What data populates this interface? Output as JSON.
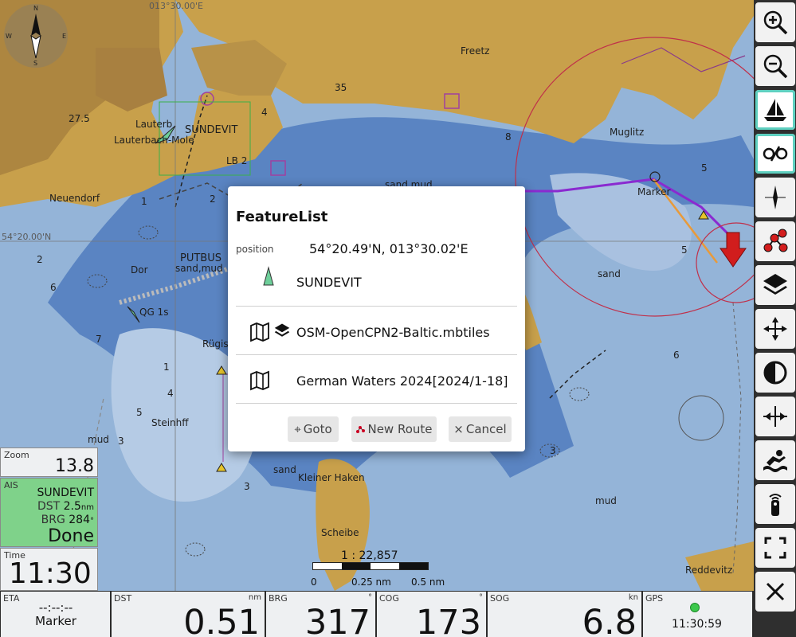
{
  "map": {
    "grid_lon": "013°30.00'E",
    "grid_lat": "54°20.00'N",
    "places": [
      "Freetz",
      "Lauterb",
      "SUNDEVIT",
      "Lauterbach-Mole",
      "Neuendorf",
      "PUTBUS",
      "sand,mud",
      "Marker",
      "Muglitz",
      "sand mud",
      "sand",
      "Rügise",
      "Steinhff",
      "Kleiner Haken",
      "Scheibe",
      "Reddevitz",
      "mud",
      "QG 1s",
      "LB 2",
      "Dor",
      "mud",
      "sand"
    ],
    "depths": [
      "27.5",
      "35",
      "2",
      "6",
      "4",
      "5",
      "3",
      "1",
      "7",
      "8",
      "3",
      "6",
      "5",
      "2",
      "4",
      "1",
      "3",
      "5"
    ],
    "scale_ratio": "1 : 22,857",
    "scale_ticks": [
      "0",
      "0.25 nm",
      "0.5 nm"
    ]
  },
  "compass": {
    "n": "N",
    "s": "S",
    "e": "E",
    "w": "W"
  },
  "toolbar": {
    "buttons": [
      {
        "name": "zoom-in-icon"
      },
      {
        "name": "zoom-out-icon"
      },
      {
        "name": "sailboat-icon"
      },
      {
        "name": "ais-toggle-icon"
      },
      {
        "name": "compass-icon"
      },
      {
        "name": "route-icon"
      },
      {
        "name": "layers-icon"
      },
      {
        "name": "center-icon"
      },
      {
        "name": "contrast-icon"
      },
      {
        "name": "anchor-icon"
      },
      {
        "name": "mob-icon"
      },
      {
        "name": "remote-icon"
      },
      {
        "name": "fullscreen-icon"
      },
      {
        "name": "close-icon"
      }
    ]
  },
  "widgets": {
    "zoom": {
      "label": "Zoom",
      "value": "13.8"
    },
    "ais": {
      "label": "AIS",
      "name": "SUNDEVIT",
      "dst_label": "DST",
      "dst_value": "2.5",
      "dst_unit": "nm",
      "brg_label": "BRG",
      "brg_value": "284",
      "brg_unit": "°",
      "status": "Done"
    },
    "time": {
      "label": "Time",
      "value": "11:30"
    }
  },
  "bottom": {
    "eta": {
      "label": "ETA",
      "value": "--:--:--",
      "target": "Marker"
    },
    "dst": {
      "label": "DST",
      "unit": "nm",
      "value": "0.51"
    },
    "brg": {
      "label": "BRG",
      "unit": "°",
      "value": "317"
    },
    "cog": {
      "label": "COG",
      "unit": "°",
      "value": "173"
    },
    "sog": {
      "label": "SOG",
      "unit": "kn",
      "value": "6.8"
    },
    "gps": {
      "label": "GPS",
      "time": "11:30:59"
    }
  },
  "dialog": {
    "title": "FeatureList",
    "position_label": "position",
    "position_value": "54°20.49'N, 013°30.02'E",
    "rows": [
      {
        "text": "SUNDEVIT"
      },
      {
        "text": "OSM-OpenCPN2-Baltic.mbtiles"
      },
      {
        "text": "German Waters 2024[2024/1-18]"
      }
    ],
    "buttons": {
      "goto": "Goto",
      "new_route": "New Route",
      "cancel": "Cancel"
    }
  },
  "colors": {
    "land": "#c9a14a",
    "shallow": "#5c86c2",
    "deep": "#9bb7da",
    "ais_done": "#7fd28a",
    "active_outline": "#5fd0c0",
    "heading": "#d11d1d"
  }
}
